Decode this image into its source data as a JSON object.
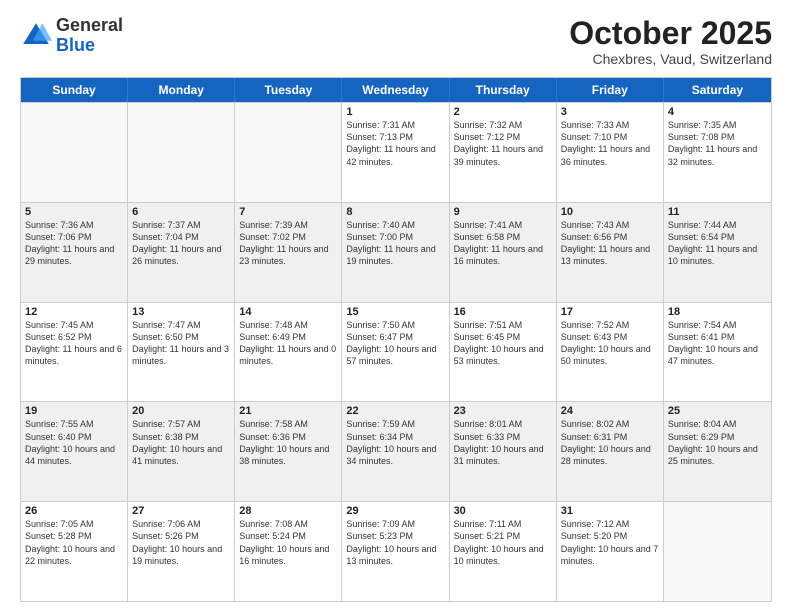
{
  "header": {
    "logo_general": "General",
    "logo_blue": "Blue",
    "month_title": "October 2025",
    "subtitle": "Chexbres, Vaud, Switzerland"
  },
  "weekdays": [
    "Sunday",
    "Monday",
    "Tuesday",
    "Wednesday",
    "Thursday",
    "Friday",
    "Saturday"
  ],
  "weeks": [
    [
      {
        "day": "",
        "sunrise": "",
        "sunset": "",
        "daylight": "",
        "empty": true
      },
      {
        "day": "",
        "sunrise": "",
        "sunset": "",
        "daylight": "",
        "empty": true
      },
      {
        "day": "",
        "sunrise": "",
        "sunset": "",
        "daylight": "",
        "empty": true
      },
      {
        "day": "1",
        "sunrise": "Sunrise: 7:31 AM",
        "sunset": "Sunset: 7:13 PM",
        "daylight": "Daylight: 11 hours and 42 minutes.",
        "empty": false
      },
      {
        "day": "2",
        "sunrise": "Sunrise: 7:32 AM",
        "sunset": "Sunset: 7:12 PM",
        "daylight": "Daylight: 11 hours and 39 minutes.",
        "empty": false
      },
      {
        "day": "3",
        "sunrise": "Sunrise: 7:33 AM",
        "sunset": "Sunset: 7:10 PM",
        "daylight": "Daylight: 11 hours and 36 minutes.",
        "empty": false
      },
      {
        "day": "4",
        "sunrise": "Sunrise: 7:35 AM",
        "sunset": "Sunset: 7:08 PM",
        "daylight": "Daylight: 11 hours and 32 minutes.",
        "empty": false
      }
    ],
    [
      {
        "day": "5",
        "sunrise": "Sunrise: 7:36 AM",
        "sunset": "Sunset: 7:06 PM",
        "daylight": "Daylight: 11 hours and 29 minutes.",
        "empty": false
      },
      {
        "day": "6",
        "sunrise": "Sunrise: 7:37 AM",
        "sunset": "Sunset: 7:04 PM",
        "daylight": "Daylight: 11 hours and 26 minutes.",
        "empty": false
      },
      {
        "day": "7",
        "sunrise": "Sunrise: 7:39 AM",
        "sunset": "Sunset: 7:02 PM",
        "daylight": "Daylight: 11 hours and 23 minutes.",
        "empty": false
      },
      {
        "day": "8",
        "sunrise": "Sunrise: 7:40 AM",
        "sunset": "Sunset: 7:00 PM",
        "daylight": "Daylight: 11 hours and 19 minutes.",
        "empty": false
      },
      {
        "day": "9",
        "sunrise": "Sunrise: 7:41 AM",
        "sunset": "Sunset: 6:58 PM",
        "daylight": "Daylight: 11 hours and 16 minutes.",
        "empty": false
      },
      {
        "day": "10",
        "sunrise": "Sunrise: 7:43 AM",
        "sunset": "Sunset: 6:56 PM",
        "daylight": "Daylight: 11 hours and 13 minutes.",
        "empty": false
      },
      {
        "day": "11",
        "sunrise": "Sunrise: 7:44 AM",
        "sunset": "Sunset: 6:54 PM",
        "daylight": "Daylight: 11 hours and 10 minutes.",
        "empty": false
      }
    ],
    [
      {
        "day": "12",
        "sunrise": "Sunrise: 7:45 AM",
        "sunset": "Sunset: 6:52 PM",
        "daylight": "Daylight: 11 hours and 6 minutes.",
        "empty": false
      },
      {
        "day": "13",
        "sunrise": "Sunrise: 7:47 AM",
        "sunset": "Sunset: 6:50 PM",
        "daylight": "Daylight: 11 hours and 3 minutes.",
        "empty": false
      },
      {
        "day": "14",
        "sunrise": "Sunrise: 7:48 AM",
        "sunset": "Sunset: 6:49 PM",
        "daylight": "Daylight: 11 hours and 0 minutes.",
        "empty": false
      },
      {
        "day": "15",
        "sunrise": "Sunrise: 7:50 AM",
        "sunset": "Sunset: 6:47 PM",
        "daylight": "Daylight: 10 hours and 57 minutes.",
        "empty": false
      },
      {
        "day": "16",
        "sunrise": "Sunrise: 7:51 AM",
        "sunset": "Sunset: 6:45 PM",
        "daylight": "Daylight: 10 hours and 53 minutes.",
        "empty": false
      },
      {
        "day": "17",
        "sunrise": "Sunrise: 7:52 AM",
        "sunset": "Sunset: 6:43 PM",
        "daylight": "Daylight: 10 hours and 50 minutes.",
        "empty": false
      },
      {
        "day": "18",
        "sunrise": "Sunrise: 7:54 AM",
        "sunset": "Sunset: 6:41 PM",
        "daylight": "Daylight: 10 hours and 47 minutes.",
        "empty": false
      }
    ],
    [
      {
        "day": "19",
        "sunrise": "Sunrise: 7:55 AM",
        "sunset": "Sunset: 6:40 PM",
        "daylight": "Daylight: 10 hours and 44 minutes.",
        "empty": false
      },
      {
        "day": "20",
        "sunrise": "Sunrise: 7:57 AM",
        "sunset": "Sunset: 6:38 PM",
        "daylight": "Daylight: 10 hours and 41 minutes.",
        "empty": false
      },
      {
        "day": "21",
        "sunrise": "Sunrise: 7:58 AM",
        "sunset": "Sunset: 6:36 PM",
        "daylight": "Daylight: 10 hours and 38 minutes.",
        "empty": false
      },
      {
        "day": "22",
        "sunrise": "Sunrise: 7:59 AM",
        "sunset": "Sunset: 6:34 PM",
        "daylight": "Daylight: 10 hours and 34 minutes.",
        "empty": false
      },
      {
        "day": "23",
        "sunrise": "Sunrise: 8:01 AM",
        "sunset": "Sunset: 6:33 PM",
        "daylight": "Daylight: 10 hours and 31 minutes.",
        "empty": false
      },
      {
        "day": "24",
        "sunrise": "Sunrise: 8:02 AM",
        "sunset": "Sunset: 6:31 PM",
        "daylight": "Daylight: 10 hours and 28 minutes.",
        "empty": false
      },
      {
        "day": "25",
        "sunrise": "Sunrise: 8:04 AM",
        "sunset": "Sunset: 6:29 PM",
        "daylight": "Daylight: 10 hours and 25 minutes.",
        "empty": false
      }
    ],
    [
      {
        "day": "26",
        "sunrise": "Sunrise: 7:05 AM",
        "sunset": "Sunset: 5:28 PM",
        "daylight": "Daylight: 10 hours and 22 minutes.",
        "empty": false
      },
      {
        "day": "27",
        "sunrise": "Sunrise: 7:06 AM",
        "sunset": "Sunset: 5:26 PM",
        "daylight": "Daylight: 10 hours and 19 minutes.",
        "empty": false
      },
      {
        "day": "28",
        "sunrise": "Sunrise: 7:08 AM",
        "sunset": "Sunset: 5:24 PM",
        "daylight": "Daylight: 10 hours and 16 minutes.",
        "empty": false
      },
      {
        "day": "29",
        "sunrise": "Sunrise: 7:09 AM",
        "sunset": "Sunset: 5:23 PM",
        "daylight": "Daylight: 10 hours and 13 minutes.",
        "empty": false
      },
      {
        "day": "30",
        "sunrise": "Sunrise: 7:11 AM",
        "sunset": "Sunset: 5:21 PM",
        "daylight": "Daylight: 10 hours and 10 minutes.",
        "empty": false
      },
      {
        "day": "31",
        "sunrise": "Sunrise: 7:12 AM",
        "sunset": "Sunset: 5:20 PM",
        "daylight": "Daylight: 10 hours and 7 minutes.",
        "empty": false
      },
      {
        "day": "",
        "sunrise": "",
        "sunset": "",
        "daylight": "",
        "empty": true
      }
    ]
  ]
}
